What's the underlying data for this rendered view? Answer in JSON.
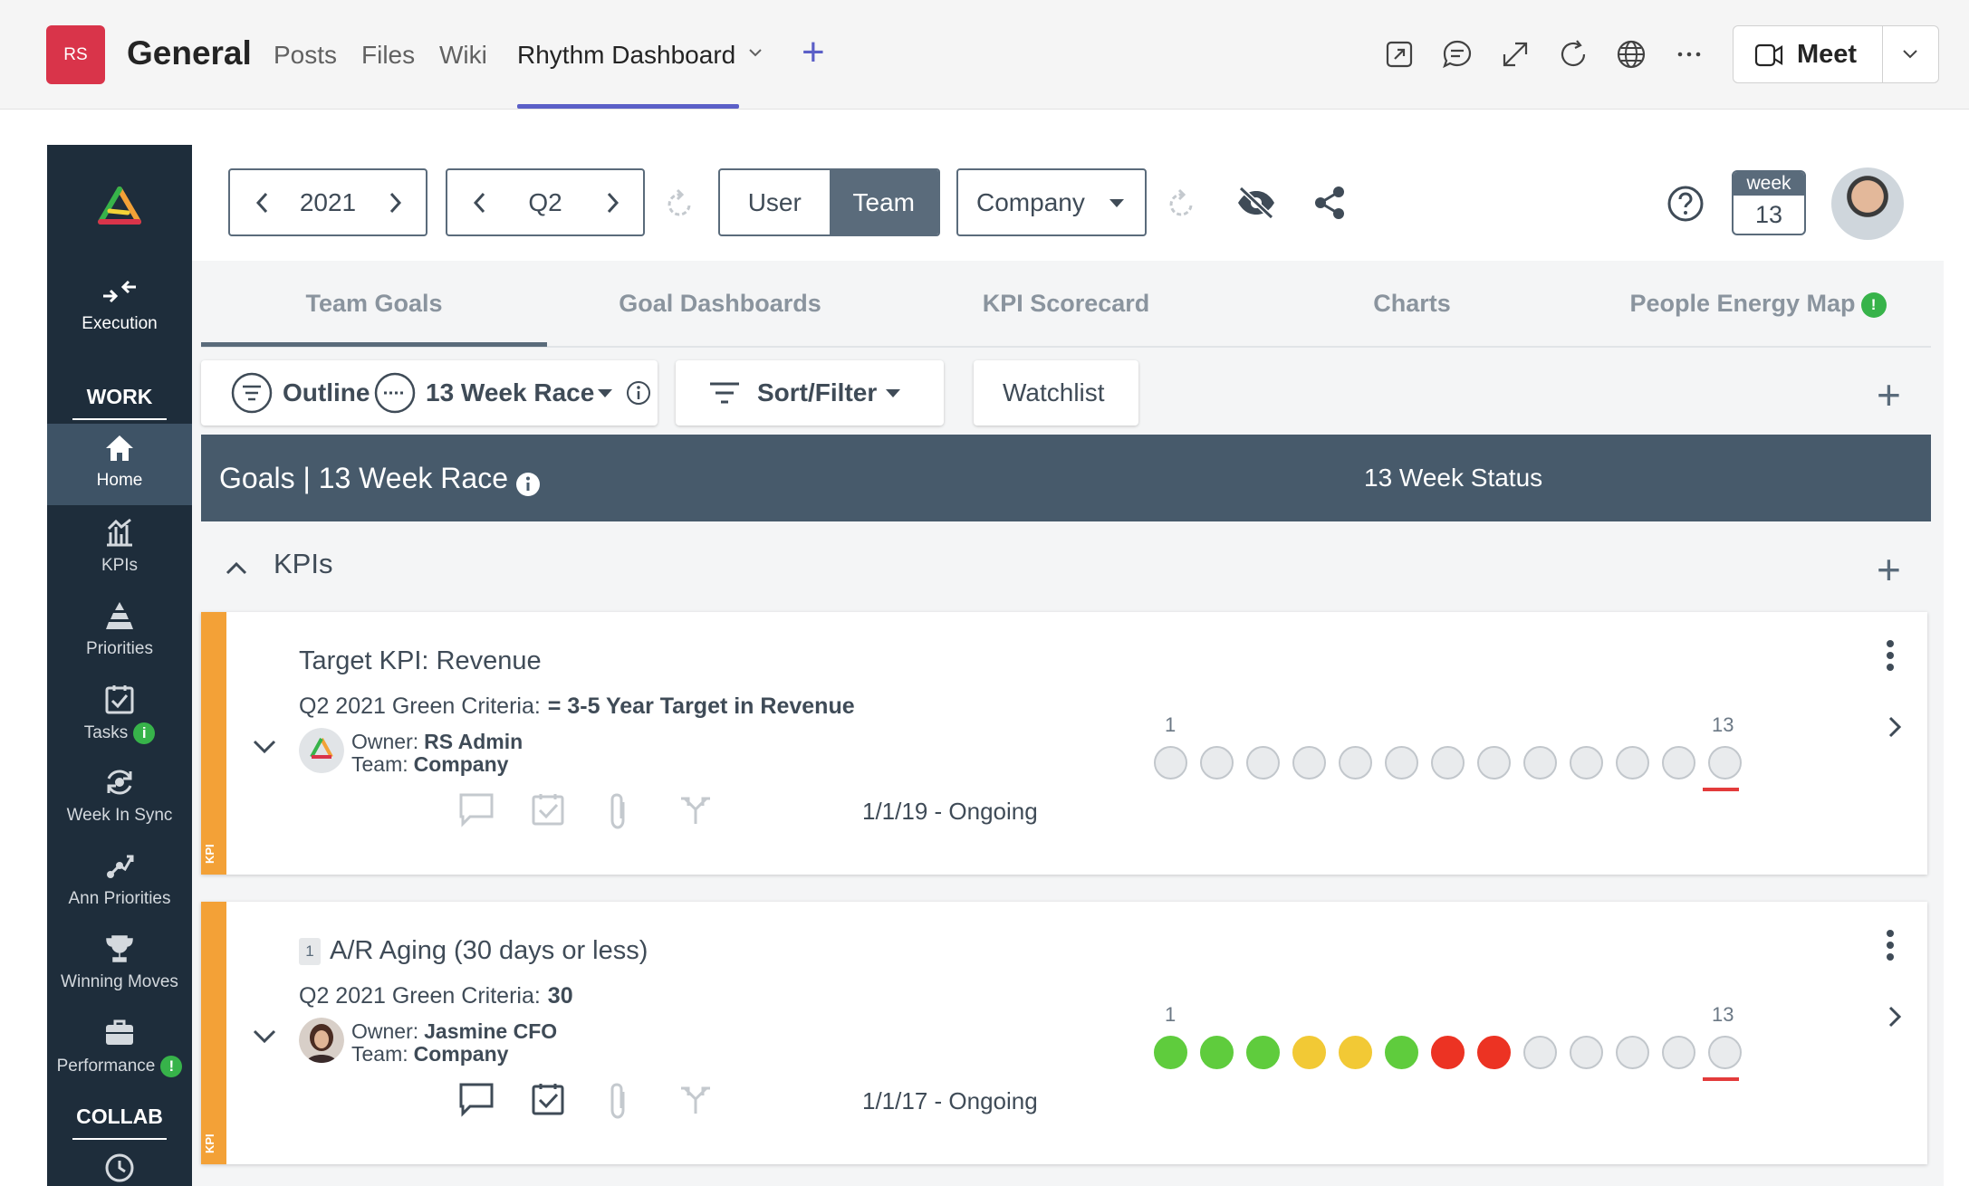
{
  "teams_bar": {
    "team_initials": "RS",
    "channel_name": "General",
    "tabs": [
      {
        "label": "Posts"
      },
      {
        "label": "Files"
      },
      {
        "label": "Wiki"
      },
      {
        "label": "Rhythm Dashboard",
        "active": true
      }
    ],
    "meet_label": "Meet",
    "icons": [
      "popout-icon",
      "chat-icon",
      "expand-icon",
      "refresh-icon",
      "globe-icon",
      "more-icon"
    ]
  },
  "sidebar": {
    "execution_label": "Execution",
    "work_section": "WORK",
    "items": [
      {
        "label": "Home",
        "icon": "home-icon",
        "active": true
      },
      {
        "label": "KPIs",
        "icon": "kpi-icon"
      },
      {
        "label": "Priorities",
        "icon": "priorities-icon"
      },
      {
        "label": "Tasks",
        "icon": "tasks-icon",
        "badge": "i"
      },
      {
        "label": "Week In Sync",
        "icon": "sync-icon"
      },
      {
        "label": "Ann Priorities",
        "icon": "ann-priorities-icon"
      },
      {
        "label": "Winning Moves",
        "icon": "trophy-icon"
      },
      {
        "label": "Performance",
        "icon": "briefcase-icon",
        "badge": "!"
      }
    ],
    "collab_section": "COLLAB"
  },
  "toolbar": {
    "year": "2021",
    "quarter": "Q2",
    "view_toggle": {
      "user": "User",
      "team": "Team",
      "selected": "Team"
    },
    "scope": "Company",
    "week_label": "week",
    "week_number": "13"
  },
  "tabs": {
    "items": [
      "Team Goals",
      "Goal Dashboards",
      "KPI Scorecard",
      "Charts",
      "People Energy Map"
    ],
    "active": "Team Goals",
    "badge_on_last": "!"
  },
  "filters": {
    "outline_label": "Outline",
    "race_label": "13 Week Race",
    "sort_label": "Sort/Filter",
    "watchlist_label": "Watchlist"
  },
  "goals_header": {
    "title": "Goals | 13 Week Race",
    "status_label": "13 Week Status"
  },
  "kpi_section": {
    "label": "KPIs"
  },
  "kpis": [
    {
      "title": "Target KPI: Revenue",
      "criteria_label": "Q2 2021 Green Criteria:",
      "criteria_value": "= 3-5 Year Target in Revenue",
      "owner_label": "Owner:",
      "owner": "RS Admin",
      "team_label": "Team:",
      "team": "Company",
      "date_range": "1/1/19 - Ongoing",
      "week_start": "1",
      "week_end": "13",
      "stripe_label": "KPI",
      "weeks": [
        "none",
        "none",
        "none",
        "none",
        "none",
        "none",
        "none",
        "none",
        "none",
        "none",
        "none",
        "none",
        "none"
      ]
    },
    {
      "number": "1",
      "title": "A/R Aging (30 days or less)",
      "criteria_label": "Q2 2021 Green Criteria:",
      "criteria_value": "30",
      "owner_label": "Owner:",
      "owner": "Jasmine CFO",
      "team_label": "Team:",
      "team": "Company",
      "date_range": "1/1/17 - Ongoing",
      "week_start": "1",
      "week_end": "13",
      "stripe_label": "KPI",
      "weeks": [
        "green",
        "green",
        "green",
        "yellow",
        "yellow",
        "green",
        "red",
        "red",
        "none",
        "none",
        "none",
        "none",
        "none"
      ]
    }
  ],
  "status_colors": {
    "green": "#5fcc3d",
    "yellow": "#f2c935",
    "red": "#ec3323",
    "none": "#e9ebed"
  }
}
